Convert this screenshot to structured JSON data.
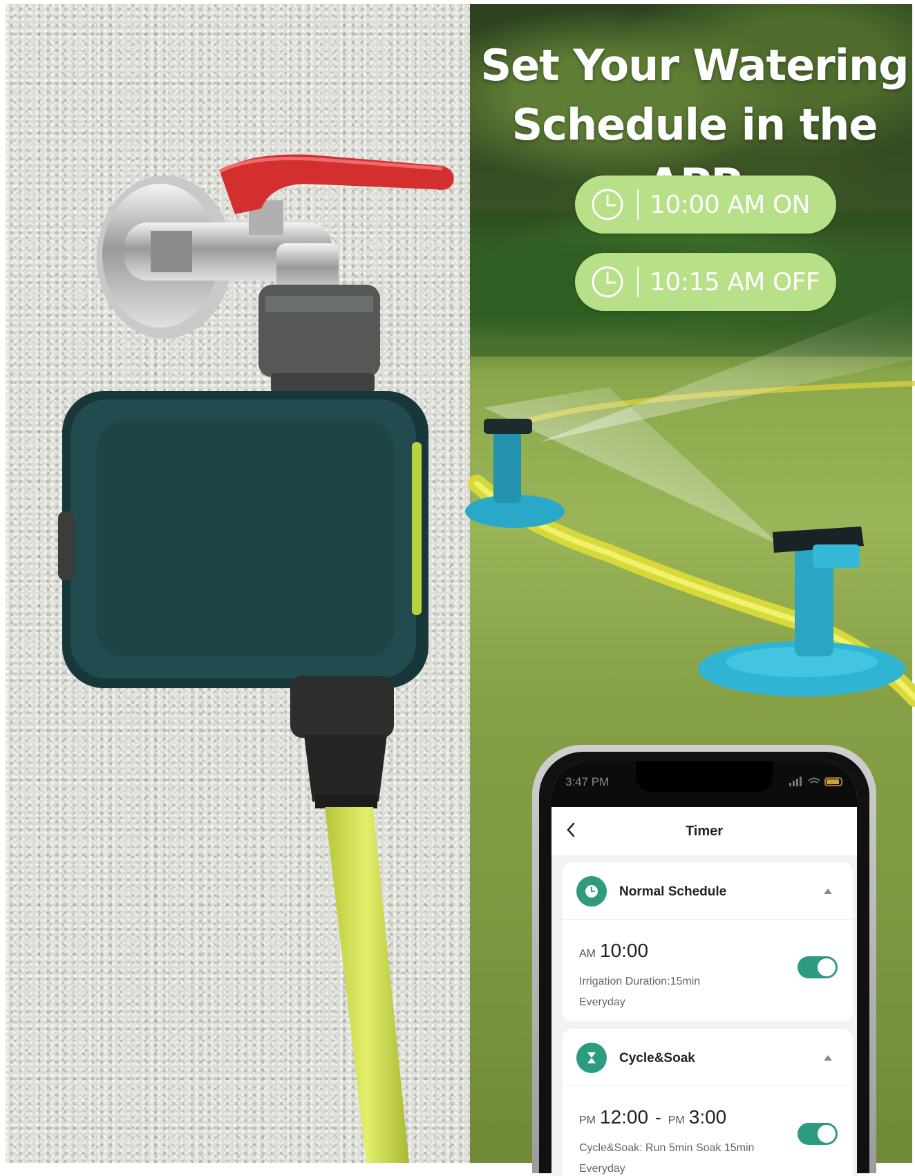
{
  "headline": {
    "line1": "Set Your Watering",
    "line2": "Schedule in the APP"
  },
  "pills": {
    "on_text": "10:00 AM ON",
    "off_text": "10:15 AM OFF",
    "color": "#b7e088"
  },
  "phone": {
    "status_time": "3:47 PM",
    "app_title": "Timer",
    "accent": "#2e9a80",
    "normal_schedule": {
      "title": "Normal Schedule",
      "ampm": "AM",
      "time": "10:00",
      "duration": "Irrigation Duration:15min",
      "repeat": "Everyday",
      "enabled": true
    },
    "cycle_soak": {
      "title": "Cycle&Soak",
      "start_ampm": "PM",
      "start_time": "12:00",
      "separator": "-",
      "end_ampm": "PM",
      "end_time": "3:00",
      "detail": "Cycle&Soak: Run 5min Soak 15min",
      "repeat": "Everyday",
      "enabled": true
    }
  },
  "icons": {
    "pill_icon": "clock-icon",
    "normal_schedule_icon": "clock-icon",
    "cycle_soak_icon": "hourglass-icon",
    "back_icon": "chevron-left-icon"
  }
}
